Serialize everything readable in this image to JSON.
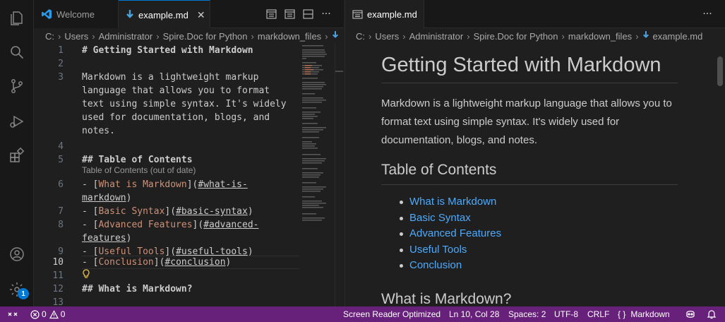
{
  "tabs_left": [
    {
      "label": "Welcome",
      "icon": "vscode-logo-icon"
    },
    {
      "label": "example.md",
      "icon": "markdown-icon"
    }
  ],
  "tabs_right": [
    {
      "label": "example.md",
      "icon": "preview-icon"
    }
  ],
  "breadcrumb_left": [
    "C:",
    "Users",
    "Administrator",
    "Spire.Doc for Python",
    "markdown_files"
  ],
  "breadcrumb_right": [
    "C:",
    "Users",
    "Administrator",
    "Spire.Doc for Python",
    "markdown_files",
    "example.md"
  ],
  "editor": {
    "line_numbers": [
      "1",
      "2",
      "3",
      "",
      "",
      "",
      "",
      "4",
      "5",
      "",
      "6",
      "",
      "7",
      "8",
      "",
      "9",
      "10",
      "11",
      "12",
      "13"
    ],
    "lines": {
      "l1": "# Getting Started with Markdown",
      "l3a": "Markdown is a lightweight markup",
      "l3b": "language that allows you to format",
      "l3c": "text using simple syntax. It's widely",
      "l3d": "used for documentation, blogs, and",
      "l3e": "notes.",
      "l5": "## Table of Contents",
      "codelens": "Table of Contents (out of date)",
      "l6_pre": "- [",
      "l6_label": "What is Markdown",
      "l6_mid": "](",
      "l6_link_a": "#what-is-",
      "l6_link_b": "markdown",
      "l6_post": ")",
      "l7_label": "Basic Syntax",
      "l7_link": "#basic-syntax",
      "l8_label": "Advanced Features",
      "l8_link_a": "#advanced-",
      "l8_link_b": "features",
      "l9_label": "Useful Tools",
      "l9_link": "#useful-tools",
      "l10_label": "Conclusion",
      "l10_link": "#conclusion",
      "l12": "## What is Markdown?"
    }
  },
  "preview": {
    "h1": "Getting Started with Markdown",
    "paragraph": "Markdown is a lightweight markup language that allows you to format text using simple syntax. It's widely used for documentation, blogs, and notes.",
    "toc_heading": "Table of Contents",
    "toc_items": [
      "What is Markdown",
      "Basic Syntax",
      "Advanced Features",
      "Useful Tools",
      "Conclusion"
    ],
    "h2_next": "What is Markdown?"
  },
  "status": {
    "errors": "0",
    "warnings": "0",
    "screen_reader": "Screen Reader Optimized",
    "position": "Ln 10, Col 28",
    "spaces": "Spaces: 2",
    "encoding": "UTF-8",
    "eol": "CRLF",
    "language": "Markdown",
    "language_icon": "{ }"
  },
  "badge_count": "1",
  "colors": {
    "status_bar": "#68217a",
    "accent": "#0078d4",
    "link": "#4daafc",
    "md_link_label": "#ce9178"
  }
}
